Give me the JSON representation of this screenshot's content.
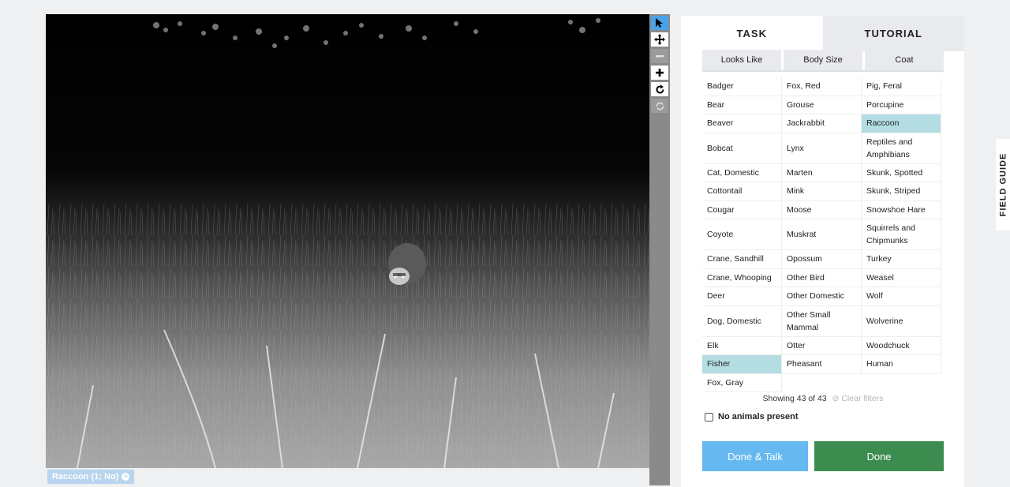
{
  "viewer": {
    "tools": [
      {
        "name": "pointer-tool-button",
        "icon": "cursor-icon",
        "state": "active"
      },
      {
        "name": "pan-tool-button",
        "icon": "move-icon",
        "state": "normal"
      },
      {
        "name": "zoom-out-button",
        "icon": "minus-icon",
        "state": "disabled"
      },
      {
        "name": "zoom-in-button",
        "icon": "plus-icon",
        "state": "normal"
      },
      {
        "name": "rotate-button",
        "icon": "rotate-icon",
        "state": "normal"
      },
      {
        "name": "reset-button",
        "icon": "refresh-icon",
        "state": "disabled"
      }
    ],
    "subject_tag": "Raccoon (1; No)"
  },
  "tabs": [
    {
      "label": "TASK",
      "active": true
    },
    {
      "label": "TUTORIAL",
      "active": false
    }
  ],
  "filters": [
    "Looks Like",
    "Body Size",
    "Coat"
  ],
  "species": [
    [
      "Badger",
      "Fox, Red",
      "Pig, Feral"
    ],
    [
      "Bear",
      "Grouse",
      "Porcupine"
    ],
    [
      "Beaver",
      "Jackrabbit",
      "Raccoon"
    ],
    [
      "Bobcat",
      "Lynx",
      "Reptiles and Amphibians"
    ],
    [
      "Cat, Domestic",
      "Marten",
      "Skunk, Spotted"
    ],
    [
      "Cottontail",
      "Mink",
      "Skunk, Striped"
    ],
    [
      "Cougar",
      "Moose",
      "Snowshoe Hare"
    ],
    [
      "Coyote",
      "Muskrat",
      "Squirrels and Chipmunks"
    ],
    [
      "Crane, Sandhill",
      "Opossum",
      "Turkey"
    ],
    [
      "Crane, Whooping",
      "Other Bird",
      "Weasel"
    ],
    [
      "Deer",
      "Other Domestic",
      "Wolf"
    ],
    [
      "Dog, Domestic",
      "Other Small Mammal",
      "Wolverine"
    ],
    [
      "Elk",
      "Otter",
      "Woodchuck"
    ],
    [
      "Fisher",
      "Pheasant",
      "Human"
    ],
    [
      "Fox, Gray",
      "",
      ""
    ]
  ],
  "selected_species": [
    "Raccoon",
    "Fisher"
  ],
  "showing_text": "Showing 43 of 43",
  "clear_filters": "Clear filters",
  "no_animals_label": "No animals present",
  "done_talk_label": "Done & Talk",
  "done_label": "Done",
  "field_guide_label": "FIELD GUIDE",
  "colors": {
    "selected": "#b3dde2",
    "done_talk": "#65b8f0",
    "done": "#3d8c4f",
    "active_tool": "#4aa3e8"
  }
}
